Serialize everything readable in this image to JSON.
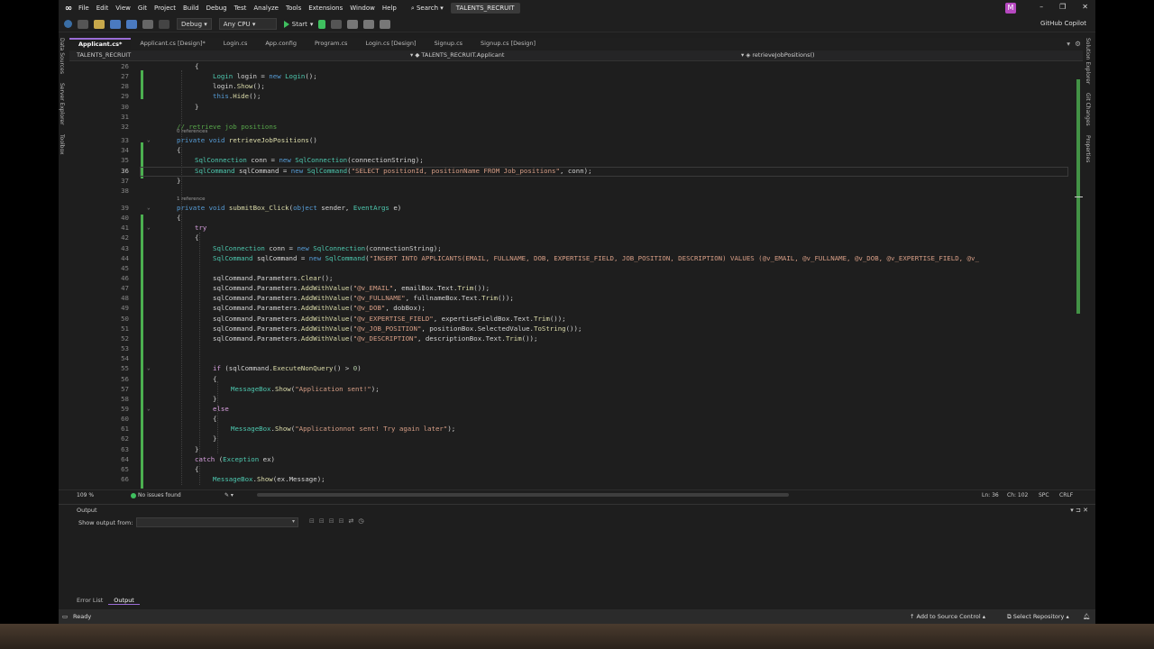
{
  "menubar": {
    "items": [
      "File",
      "Edit",
      "View",
      "Git",
      "Project",
      "Build",
      "Debug",
      "Test",
      "Analyze",
      "Tools",
      "Extensions",
      "Window",
      "Help"
    ],
    "search": "Search ▾",
    "solution": "TALENTS_RECRUIT",
    "avatar": "M"
  },
  "toolbar": {
    "config": "Debug",
    "platform": "Any CPU",
    "start": "Start",
    "copilot": "GitHub Copilot"
  },
  "tabs": [
    "Applicant.cs*",
    "Applicant.cs [Design]*",
    "Login.cs",
    "App.config",
    "Program.cs",
    "Login.cs [Design]",
    "Signup.cs",
    "Signup.cs [Design]"
  ],
  "navbar": {
    "project": "TALENTS_RECRUIT",
    "class": "TALENTS_RECRUIT.Applicant",
    "member": "retrieveJobPositions()"
  },
  "side_left": [
    "Data Sources",
    "Server Explorer",
    "Toolbox"
  ],
  "side_right": [
    "Solution Explorer",
    "Git Changes",
    "Properties"
  ],
  "code": {
    "lines": [
      {
        "n": "26",
        "segs": [
          [
            "",
            "{"
          ]
        ]
      },
      {
        "n": "27",
        "segs": [
          [
            "ty",
            "Login"
          ],
          [
            "",
            " login = "
          ],
          [
            "kw",
            "new"
          ],
          [
            "",
            " "
          ],
          [
            "ty",
            "Login"
          ],
          [
            "",
            "();"
          ]
        ]
      },
      {
        "n": "28",
        "segs": [
          [
            "",
            "login."
          ],
          [
            "fn",
            "Show"
          ],
          [
            "",
            "();"
          ]
        ]
      },
      {
        "n": "29",
        "segs": [
          [
            "kw",
            "this"
          ],
          [
            "",
            "."
          ],
          [
            "fn",
            "Hide"
          ],
          [
            "",
            "();"
          ]
        ]
      },
      {
        "n": "30",
        "segs": [
          [
            "",
            "}"
          ]
        ]
      },
      {
        "n": "31",
        "segs": []
      },
      {
        "n": "32",
        "segs": [
          [
            "cm",
            "// retrieve job positions"
          ]
        ]
      },
      {
        "n": "33",
        "segs": [
          [
            "kw",
            "private"
          ],
          [
            "",
            " "
          ],
          [
            "kw",
            "void"
          ],
          [
            "",
            " "
          ],
          [
            "fn",
            "retrieveJobPositions"
          ],
          [
            "",
            "()"
          ]
        ]
      },
      {
        "n": "34",
        "segs": [
          [
            "",
            "{"
          ]
        ]
      },
      {
        "n": "35",
        "segs": [
          [
            "ty",
            "SqlConnection"
          ],
          [
            "",
            " conn = "
          ],
          [
            "kw",
            "new"
          ],
          [
            "",
            " "
          ],
          [
            "ty",
            "SqlConnection"
          ],
          [
            "",
            "(connectionString);"
          ]
        ]
      },
      {
        "n": "36",
        "segs": [
          [
            "ty",
            "SqlCommand"
          ],
          [
            "",
            " sqlCommand = "
          ],
          [
            "kw",
            "new"
          ],
          [
            "",
            " "
          ],
          [
            "ty",
            "SqlCommand"
          ],
          [
            "",
            "("
          ],
          [
            "st",
            "\"SELECT positionId, positionName FROM Job_positions\""
          ],
          [
            "",
            ", conn);"
          ]
        ]
      },
      {
        "n": "37",
        "segs": [
          [
            "",
            "}"
          ]
        ]
      },
      {
        "n": "38",
        "segs": []
      },
      {
        "n": "39",
        "segs": [
          [
            "kw",
            "private"
          ],
          [
            "",
            " "
          ],
          [
            "kw",
            "void"
          ],
          [
            "",
            " "
          ],
          [
            "fn",
            "submitBox_Click"
          ],
          [
            "",
            "("
          ],
          [
            "kw",
            "object"
          ],
          [
            "",
            " sender, "
          ],
          [
            "ty",
            "EventArgs"
          ],
          [
            "",
            " e)"
          ]
        ]
      },
      {
        "n": "40",
        "segs": [
          [
            "",
            "{"
          ]
        ]
      },
      {
        "n": "41",
        "segs": [
          [
            "kw2",
            "try"
          ]
        ]
      },
      {
        "n": "42",
        "segs": [
          [
            "",
            "{"
          ]
        ]
      },
      {
        "n": "43",
        "segs": [
          [
            "ty",
            "SqlConnection"
          ],
          [
            "",
            " conn = "
          ],
          [
            "kw",
            "new"
          ],
          [
            "",
            " "
          ],
          [
            "ty",
            "SqlConnection"
          ],
          [
            "",
            "(connectionString);"
          ]
        ]
      },
      {
        "n": "44",
        "segs": [
          [
            "ty",
            "SqlCommand"
          ],
          [
            "",
            " sqlCommand = "
          ],
          [
            "kw",
            "new"
          ],
          [
            "",
            " "
          ],
          [
            "ty",
            "SqlCommand"
          ],
          [
            "",
            "("
          ],
          [
            "st",
            "\"INSERT INTO APPLICANTS(EMAIL, FULLNAME, DOB, EXPERTISE_FIELD, JOB_POSITION, DESCRIPTION) VALUES (@v_EMAIL, @v_FULLNAME, @v_DOB, @v_EXPERTISE_FIELD, @v_"
          ]
        ]
      },
      {
        "n": "45",
        "segs": []
      },
      {
        "n": "46",
        "segs": [
          [
            "",
            "sqlCommand.Parameters."
          ],
          [
            "fn",
            "Clear"
          ],
          [
            "",
            "();"
          ]
        ]
      },
      {
        "n": "47",
        "segs": [
          [
            "",
            "sqlCommand.Parameters."
          ],
          [
            "fn",
            "AddWithValue"
          ],
          [
            "",
            "("
          ],
          [
            "st",
            "\"@v_EMAIL\""
          ],
          [
            "",
            ", emailBox.Text."
          ],
          [
            "fn",
            "Trim"
          ],
          [
            "",
            "());"
          ]
        ]
      },
      {
        "n": "48",
        "segs": [
          [
            "",
            "sqlCommand.Parameters."
          ],
          [
            "fn",
            "AddWithValue"
          ],
          [
            "",
            "("
          ],
          [
            "st",
            "\"@v_FULLNAME\""
          ],
          [
            "",
            ", fullnameBox.Text."
          ],
          [
            "fn",
            "Trim"
          ],
          [
            "",
            "());"
          ]
        ]
      },
      {
        "n": "49",
        "segs": [
          [
            "",
            "sqlCommand.Parameters."
          ],
          [
            "fn",
            "AddWithValue"
          ],
          [
            "",
            "("
          ],
          [
            "st",
            "\"@v_DOB\""
          ],
          [
            "",
            ", dobBox);"
          ]
        ]
      },
      {
        "n": "50",
        "segs": [
          [
            "",
            "sqlCommand.Parameters."
          ],
          [
            "fn",
            "AddWithValue"
          ],
          [
            "",
            "("
          ],
          [
            "st",
            "\"@v_EXPERTISE_FIELD\""
          ],
          [
            "",
            ", expertiseFieldBox.Text."
          ],
          [
            "fn",
            "Trim"
          ],
          [
            "",
            "());"
          ]
        ]
      },
      {
        "n": "51",
        "segs": [
          [
            "",
            "sqlCommand.Parameters."
          ],
          [
            "fn",
            "AddWithValue"
          ],
          [
            "",
            "("
          ],
          [
            "st",
            "\"@v_JOB_POSITION\""
          ],
          [
            "",
            ", positionBox.SelectedValue."
          ],
          [
            "fn",
            "ToString"
          ],
          [
            "",
            "());"
          ]
        ]
      },
      {
        "n": "52",
        "segs": [
          [
            "",
            "sqlCommand.Parameters."
          ],
          [
            "fn",
            "AddWithValue"
          ],
          [
            "",
            "("
          ],
          [
            "st",
            "\"@v_DESCRIPTION\""
          ],
          [
            "",
            ", descriptionBox.Text."
          ],
          [
            "fn",
            "Trim"
          ],
          [
            "",
            "());"
          ]
        ]
      },
      {
        "n": "53",
        "segs": []
      },
      {
        "n": "54",
        "segs": []
      },
      {
        "n": "55",
        "segs": [
          [
            "kw2",
            "if"
          ],
          [
            "",
            " (sqlCommand."
          ],
          [
            "fn",
            "ExecuteNonQuery"
          ],
          [
            "",
            "() > "
          ],
          [
            "nm",
            "0"
          ],
          [
            "",
            ")"
          ]
        ]
      },
      {
        "n": "56",
        "segs": [
          [
            "",
            "{"
          ]
        ]
      },
      {
        "n": "57",
        "segs": [
          [
            "ty",
            "MessageBox"
          ],
          [
            "",
            "."
          ],
          [
            "fn",
            "Show"
          ],
          [
            "",
            "("
          ],
          [
            "st",
            "\"Application sent!\""
          ],
          [
            "",
            ");"
          ]
        ]
      },
      {
        "n": "58",
        "segs": [
          [
            "",
            "}"
          ]
        ]
      },
      {
        "n": "59",
        "segs": [
          [
            "kw2",
            "else"
          ]
        ]
      },
      {
        "n": "60",
        "segs": [
          [
            "",
            "{"
          ]
        ]
      },
      {
        "n": "61",
        "segs": [
          [
            "ty",
            "MessageBox"
          ],
          [
            "",
            "."
          ],
          [
            "fn",
            "Show"
          ],
          [
            "",
            "("
          ],
          [
            "st",
            "\"Applicationnot sent! Try again later\""
          ],
          [
            "",
            ");"
          ]
        ]
      },
      {
        "n": "62",
        "segs": [
          [
            "",
            "}"
          ]
        ]
      },
      {
        "n": "63",
        "segs": [
          [
            "",
            "}"
          ]
        ]
      },
      {
        "n": "64",
        "segs": [
          [
            "kw2",
            "catch"
          ],
          [
            "",
            " ("
          ],
          [
            "ty",
            "Exception"
          ],
          [
            "",
            " ex)"
          ]
        ]
      },
      {
        "n": "65",
        "segs": [
          [
            "",
            "{"
          ]
        ]
      },
      {
        "n": "66",
        "segs": [
          [
            "ty",
            "MessageBox"
          ],
          [
            "",
            "."
          ],
          [
            "fn",
            "Show"
          ],
          [
            "",
            "(ex.Message);"
          ]
        ]
      }
    ],
    "refs_0": "0 references",
    "refs_1": "1 reference"
  },
  "editor_status": {
    "zoom": "109 %",
    "issues": "No issues found",
    "line": "Ln: 36",
    "col": "Ch: 102",
    "ws": "SPC",
    "eol": "CRLF"
  },
  "output": {
    "title": "Output",
    "show_from": "Show output from:"
  },
  "bottom_tabs": [
    "Error List",
    "Output"
  ],
  "status": {
    "ready": "Ready",
    "source_control": "Add to Source Control",
    "repo": "Select Repository"
  }
}
